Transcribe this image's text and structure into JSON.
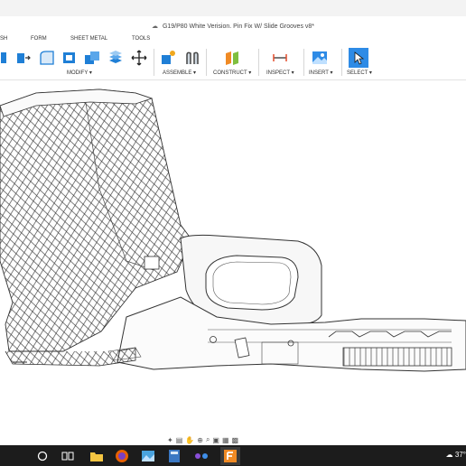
{
  "document": {
    "title": "G19/P80 White Verision. Pin Fix W/ Slide Grooves v8*"
  },
  "ribbon_tabs": [
    "SH",
    "FORM",
    "SHEET METAL",
    "TOOLS"
  ],
  "ribbon_groups": [
    {
      "label": "MODIFY ▾"
    },
    {
      "label": "ASSEMBLE ▾"
    },
    {
      "label": "CONSTRUCT ▾"
    },
    {
      "label": "INSPECT ▾"
    },
    {
      "label": "INSERT ▾"
    },
    {
      "label": "SELECT ▾"
    }
  ],
  "icons": {
    "title": "cloud-icon",
    "modify": [
      "push-pull-icon",
      "fillet-icon",
      "shell-icon",
      "combine-icon",
      "scale-icon",
      "move-icon"
    ],
    "assemble": [
      "new-component-icon",
      "joint-icon"
    ],
    "construct": "offset-plane-icon",
    "inspect": "measure-icon",
    "insert": "insert-image-icon",
    "select": "select-cursor-icon"
  },
  "navbar_icons": [
    "orbit-icon",
    "look-at-icon",
    "pan-icon",
    "zoom-icon",
    "fit-icon",
    "display-settings-icon",
    "grid-settings-icon",
    "viewports-icon"
  ],
  "taskbar": {
    "items": [
      "start-search-icon",
      "task-view-icon",
      "file-explorer-icon",
      "firefox-icon",
      "photos-icon",
      "calculator-icon",
      "media-app-icon",
      "fusion-360-icon"
    ],
    "weather_temp": "37°"
  },
  "colors": {
    "accent_blue": "#1f7fd6",
    "select_highlight": "#2e8be6",
    "taskbar_bg": "#1c1c1c",
    "model_stroke": "#333333",
    "fusion_orange": "#f08a24"
  }
}
